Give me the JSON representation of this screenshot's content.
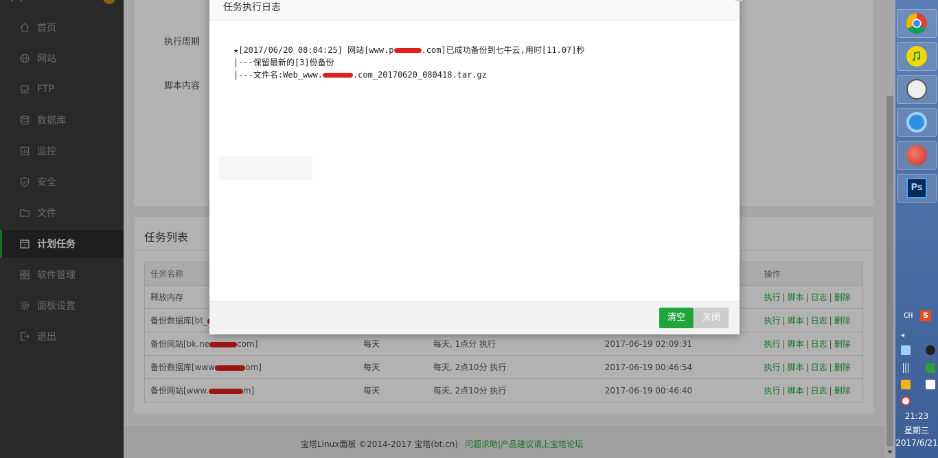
{
  "sidebar": {
    "items": [
      {
        "label": "首页",
        "icon": "home-icon"
      },
      {
        "label": "网站",
        "icon": "globe-icon"
      },
      {
        "label": "FTP",
        "icon": "ftp-icon"
      },
      {
        "label": "数据库",
        "icon": "database-icon"
      },
      {
        "label": "监控",
        "icon": "monitor-icon"
      },
      {
        "label": "安全",
        "icon": "shield-icon"
      },
      {
        "label": "文件",
        "icon": "folder-icon"
      },
      {
        "label": "计划任务",
        "icon": "calendar-icon",
        "active": true
      },
      {
        "label": "软件管理",
        "icon": "grid-icon"
      },
      {
        "label": "面板设置",
        "icon": "gear-icon"
      },
      {
        "label": "退出",
        "icon": "logout-icon"
      }
    ]
  },
  "form": {
    "cycle_label": "执行周期",
    "script_label": "脚本内容"
  },
  "task_list": {
    "title": "任务列表",
    "columns": [
      "任务名称",
      "",
      "",
      "",
      "操作"
    ],
    "rows": [
      {
        "name": "释放内存",
        "cycle": "",
        "period": "",
        "time": ""
      },
      {
        "name": "备份数据库[bt_",
        "cycle": "",
        "period": "",
        "time": ""
      },
      {
        "name_prefix": "备份网站[bk.ne",
        "name_suffix": "com]",
        "cycle": "每天",
        "period": "每天, 1点分 执行",
        "time": "2017-06-19 02:09:31"
      },
      {
        "name_prefix": "备份数据库[www",
        "name_suffix": "om]",
        "cycle": "每天",
        "period": "每天, 2点10分 执行",
        "time": "2017-06-19 00:46:54"
      },
      {
        "name_prefix": "备份网站[www.",
        "name_suffix": "m]",
        "cycle": "每天",
        "period": "每天, 2点10分 执行",
        "time": "2017-06-19 00:46:40"
      }
    ],
    "ops": {
      "run": "执行",
      "script": "脚本",
      "log": "日志",
      "delete": "删除",
      "sep": "|"
    }
  },
  "dialog": {
    "title": "任务执行日志",
    "log_line1_a": "★[2017/06/20 08:04:25] 网站[www.p",
    "log_line1_b": ".com]已成功备份到七牛云,用时[11.07]秒",
    "log_line2": "|---保留最新的[3]份备份",
    "log_line3_a": "|---文件名:Web_www.",
    "log_line3_b": ".com_20170620_080418.tar.gz",
    "clear_button": "清空",
    "close_button": "关闭"
  },
  "footer": {
    "copyright": "宝塔Linux面板 ©2014-2017 宝塔(bt.cn)",
    "help_link": "问题求助|产品建议请上宝塔论坛"
  },
  "taskbar": {
    "apps": [
      "chrome-icon",
      "music-icon",
      "user-app-icon",
      "browser-icon",
      "bird-app-icon",
      "photoshop-icon"
    ],
    "ps_label": "Ps",
    "lang": "CH",
    "ime": "S",
    "time": "21:23",
    "weekday": "星期三",
    "date": "2017/6/21"
  },
  "colors": {
    "accent": "#20a53a",
    "sidebar_bg": "#3c3c3c",
    "redact": "#e02020"
  }
}
